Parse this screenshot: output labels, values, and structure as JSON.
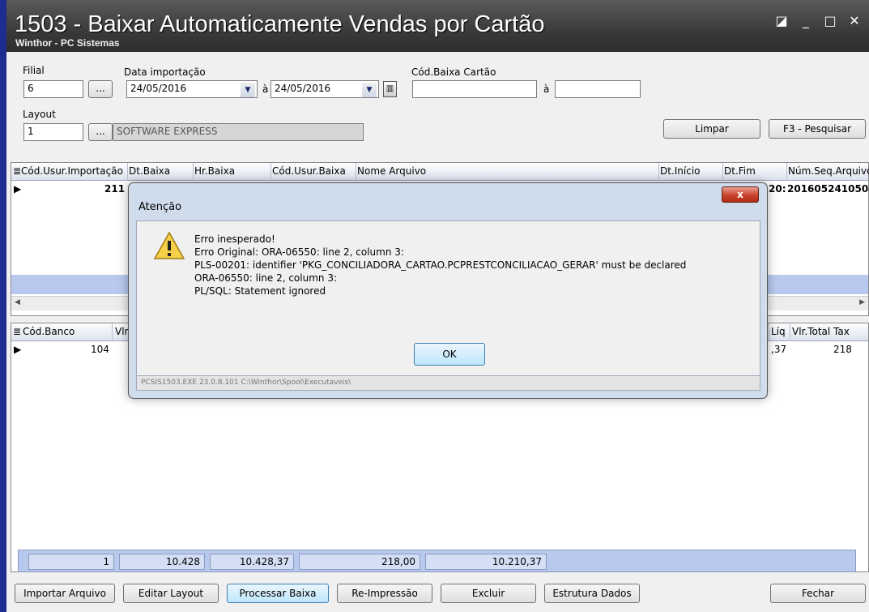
{
  "window": {
    "title": "1503 - Baixar Automaticamente Vendas por Cartão",
    "subtitle": "Winthor - PC Sistemas",
    "controls": [
      "◪",
      "_",
      "□",
      "✕"
    ]
  },
  "filters": {
    "filial_label": "Filial",
    "filial_value": "6",
    "data_label": "Data importação",
    "data_from": "24/05/2016",
    "data_sep": "à",
    "data_to": "24/05/2016",
    "cod_label": "Cód.Baixa Cartão",
    "cod_from": "",
    "cod_sep": "à",
    "cod_to": "",
    "layout_label": "Layout",
    "layout_value": "1",
    "layout_desc": "SOFTWARE EXPRESS",
    "ellipsis": "...",
    "limpar": "Limpar",
    "pesquisar": "F3 - Pesquisar"
  },
  "grid1": {
    "columns": [
      "Cód.Usur.Importação",
      "Dt.Baixa",
      "Hr.Baixa",
      "Cód.Usur.Baixa",
      "Nome Arquivo",
      "Dt.Início",
      "Dt.Fim",
      "Núm.Seq.Arquivo"
    ],
    "row": {
      "cod_usur": "211",
      "dtfim_partial": "20:",
      "num_seq": "201605241050"
    }
  },
  "grid2": {
    "columns": [
      "Cód.Banco",
      "Vlr",
      "Líq",
      "Vlr.Total Tax"
    ],
    "row": {
      "cod_banco": "104",
      "liq_partial": ",37",
      "vlr_tax": "218"
    }
  },
  "totals": [
    "1",
    "10.428",
    "10.428,37",
    "218,00",
    "10.210,37"
  ],
  "dialog": {
    "title": "Atenção",
    "close": "x",
    "lines": [
      "Erro inesperado!",
      "Erro Original: ORA-06550: line 2, column 3:",
      "PLS-00201: identifier 'PKG_CONCILIADORA_CARTAO.PCPRESTCONCILIACAO_GERAR' must be declared",
      "ORA-06550: line 2, column 3:",
      "PL/SQL: Statement ignored"
    ],
    "ok": "OK",
    "footer": "PCSIS1503.EXE 23.0.8.101 C:\\Winthor\\Spool\\Executaveis\\"
  },
  "bottom_buttons": {
    "importar": "Importar Arquivo",
    "editar": "Editar Layout",
    "processar": "Processar Baixa",
    "reimpressao": "Re-Impressão",
    "excluir": "Excluir",
    "estrutura": "Estrutura Dados",
    "fechar": "Fechar"
  }
}
